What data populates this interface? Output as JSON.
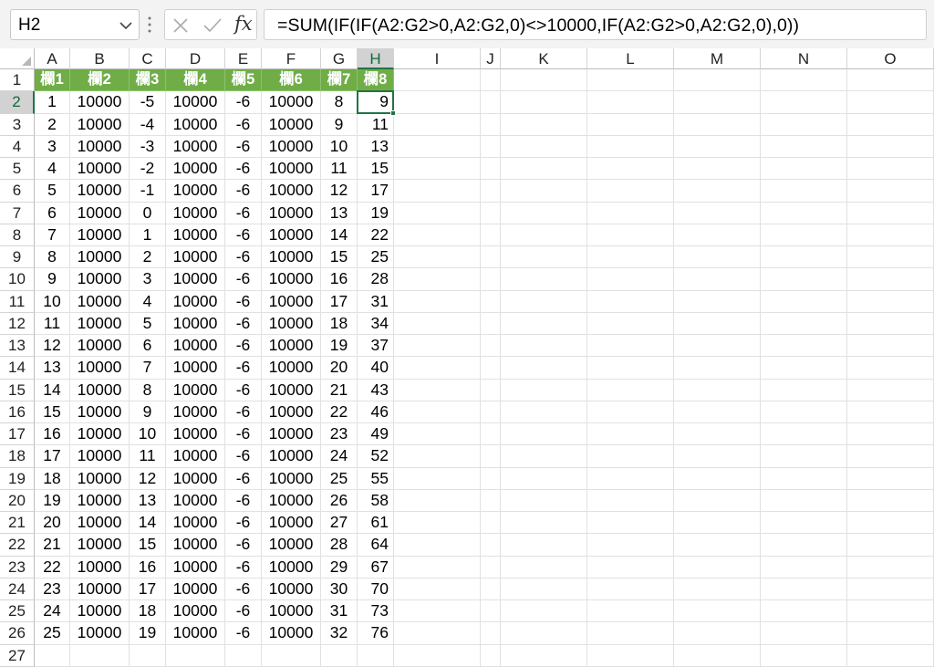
{
  "formula_bar": {
    "name_box": "H2",
    "formula": "=SUM(IF(IF(A2:G2>0,A2:G2,0)<>10000,IF(A2:G2>0,A2:G2,0),0))",
    "icons": [
      "chevron-down-icon",
      "more-vert-icon",
      "cancel-x-icon",
      "enter-check-icon",
      "insert-function-icon"
    ],
    "fx_label": "fx"
  },
  "active_cell": "H2",
  "columns": [
    "A",
    "B",
    "C",
    "D",
    "E",
    "F",
    "G",
    "H",
    "I",
    "J",
    "K",
    "L",
    "M",
    "N",
    "O"
  ],
  "header_row": [
    "欄1",
    "欄2",
    "欄3",
    "欄4",
    "欄5",
    "欄6",
    "欄7",
    "欄8"
  ],
  "row_numbers": [
    "1",
    "2",
    "3",
    "4",
    "5",
    "6",
    "7",
    "8",
    "9",
    "10",
    "11",
    "12",
    "13",
    "14",
    "15",
    "16",
    "17",
    "18",
    "19",
    "20",
    "21",
    "22",
    "23",
    "24",
    "25",
    "26",
    "27"
  ],
  "data_rows": [
    [
      "1",
      "10000",
      "-5",
      "10000",
      "-6",
      "10000",
      "8",
      "9"
    ],
    [
      "2",
      "10000",
      "-4",
      "10000",
      "-6",
      "10000",
      "9",
      "11"
    ],
    [
      "3",
      "10000",
      "-3",
      "10000",
      "-6",
      "10000",
      "10",
      "13"
    ],
    [
      "4",
      "10000",
      "-2",
      "10000",
      "-6",
      "10000",
      "11",
      "15"
    ],
    [
      "5",
      "10000",
      "-1",
      "10000",
      "-6",
      "10000",
      "12",
      "17"
    ],
    [
      "6",
      "10000",
      "0",
      "10000",
      "-6",
      "10000",
      "13",
      "19"
    ],
    [
      "7",
      "10000",
      "1",
      "10000",
      "-6",
      "10000",
      "14",
      "22"
    ],
    [
      "8",
      "10000",
      "2",
      "10000",
      "-6",
      "10000",
      "15",
      "25"
    ],
    [
      "9",
      "10000",
      "3",
      "10000",
      "-6",
      "10000",
      "16",
      "28"
    ],
    [
      "10",
      "10000",
      "4",
      "10000",
      "-6",
      "10000",
      "17",
      "31"
    ],
    [
      "11",
      "10000",
      "5",
      "10000",
      "-6",
      "10000",
      "18",
      "34"
    ],
    [
      "12",
      "10000",
      "6",
      "10000",
      "-6",
      "10000",
      "19",
      "37"
    ],
    [
      "13",
      "10000",
      "7",
      "10000",
      "-6",
      "10000",
      "20",
      "40"
    ],
    [
      "14",
      "10000",
      "8",
      "10000",
      "-6",
      "10000",
      "21",
      "43"
    ],
    [
      "15",
      "10000",
      "9",
      "10000",
      "-6",
      "10000",
      "22",
      "46"
    ],
    [
      "16",
      "10000",
      "10",
      "10000",
      "-6",
      "10000",
      "23",
      "49"
    ],
    [
      "17",
      "10000",
      "11",
      "10000",
      "-6",
      "10000",
      "24",
      "52"
    ],
    [
      "18",
      "10000",
      "12",
      "10000",
      "-6",
      "10000",
      "25",
      "55"
    ],
    [
      "19",
      "10000",
      "13",
      "10000",
      "-6",
      "10000",
      "26",
      "58"
    ],
    [
      "20",
      "10000",
      "14",
      "10000",
      "-6",
      "10000",
      "27",
      "61"
    ],
    [
      "21",
      "10000",
      "15",
      "10000",
      "-6",
      "10000",
      "28",
      "64"
    ],
    [
      "22",
      "10000",
      "16",
      "10000",
      "-6",
      "10000",
      "29",
      "67"
    ],
    [
      "23",
      "10000",
      "17",
      "10000",
      "-6",
      "10000",
      "30",
      "70"
    ],
    [
      "24",
      "10000",
      "18",
      "10000",
      "-6",
      "10000",
      "31",
      "73"
    ],
    [
      "25",
      "10000",
      "19",
      "10000",
      "-6",
      "10000",
      "32",
      "76"
    ]
  ],
  "colors": {
    "header_fill": "#70ad47",
    "header_text": "#ffffff",
    "selection": "#217346"
  }
}
